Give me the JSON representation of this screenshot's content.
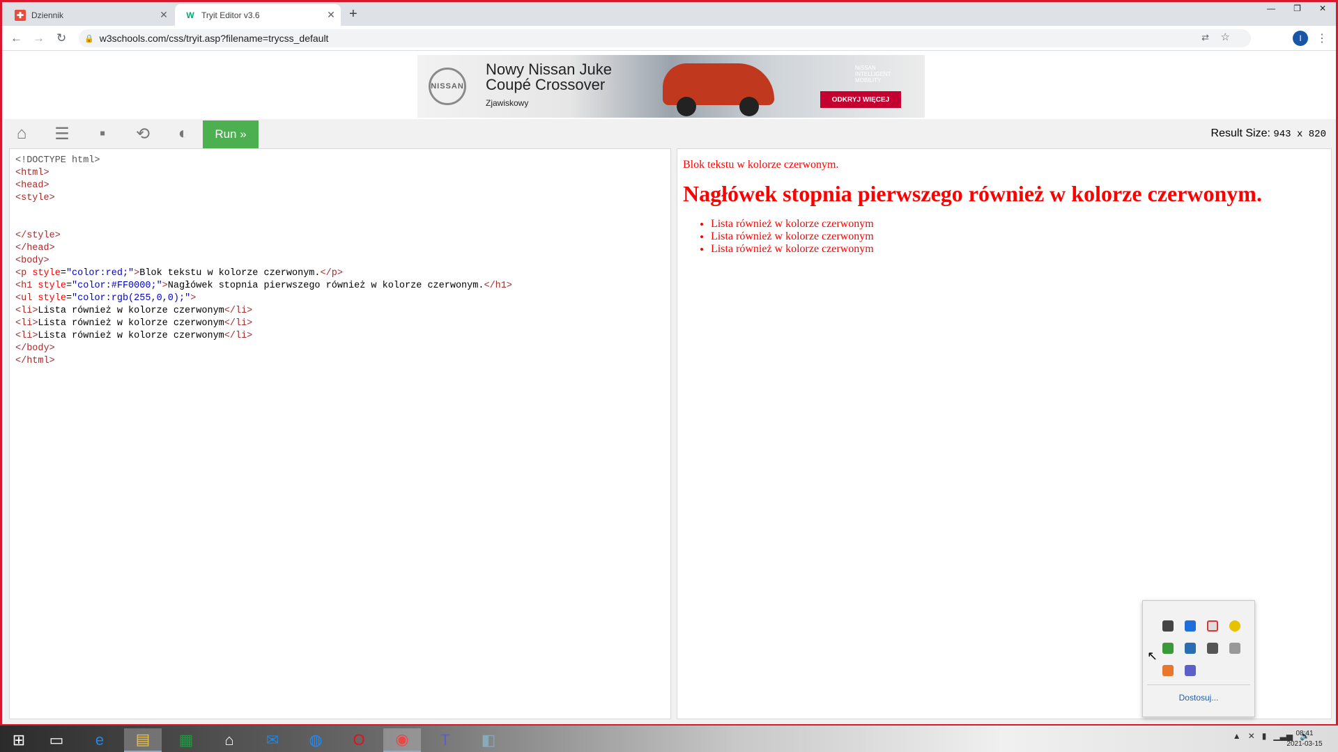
{
  "browser": {
    "tabs": [
      {
        "title": "Dziennik",
        "favicon": "dziennik-icon"
      },
      {
        "title": "Tryit Editor v3.6",
        "favicon": "w3schools-icon",
        "active": true
      }
    ],
    "url": "w3schools.com/css/tryit.asp?filename=trycss_default",
    "profile_initial": "I"
  },
  "ad": {
    "brand": "NISSAN",
    "headline_1": "Nowy Nissan Juke",
    "headline_2": "Coupé Crossover",
    "tagline": "Zjawiskowy",
    "mobility": "NISSAN INTELLIGENT MOBILITY",
    "cta": "ODKRYJ WIĘCEJ"
  },
  "toolbar": {
    "run_label": "Run »",
    "result_label": "Result Size:",
    "result_value": "943 x 820"
  },
  "code": {
    "lines": [
      "<!DOCTYPE html>",
      "<html>",
      "<head>",
      "<style>",
      "",
      "",
      "</style>",
      "</head>",
      "<body>",
      "<p style=\"color:red;\">Blok tekstu w kolorze czerwonym.</p>",
      "<h1 style=\"color:#FF0000;\">Nagłówek stopnia pierwszego również w kolorze czerwonym.</h1>",
      "<ul style=\"color:rgb(255,0,0);\">",
      "<li>Lista również w kolorze czerwonym</li>",
      "<li>Lista również w kolorze czerwonym</li>",
      "<li>Lista również w kolorze czerwonym</li>",
      "</body>",
      "</html>"
    ]
  },
  "result": {
    "paragraph": "Blok tekstu w kolorze czerwonym.",
    "heading": "Nagłówek stopnia pierwszego również w kolorze czerwonym.",
    "list": [
      "Lista również w kolorze czerwonym",
      "Lista również w kolorze czerwonym",
      "Lista również w kolorze czerwonym"
    ]
  },
  "tray": {
    "customize_label": "Dostosuj..."
  },
  "clock": {
    "time": "08:41",
    "date": "2021-03-15"
  },
  "colors": {
    "run_button": "#4caf50",
    "frame": "#d9182d",
    "result_text": "#ff0000"
  }
}
